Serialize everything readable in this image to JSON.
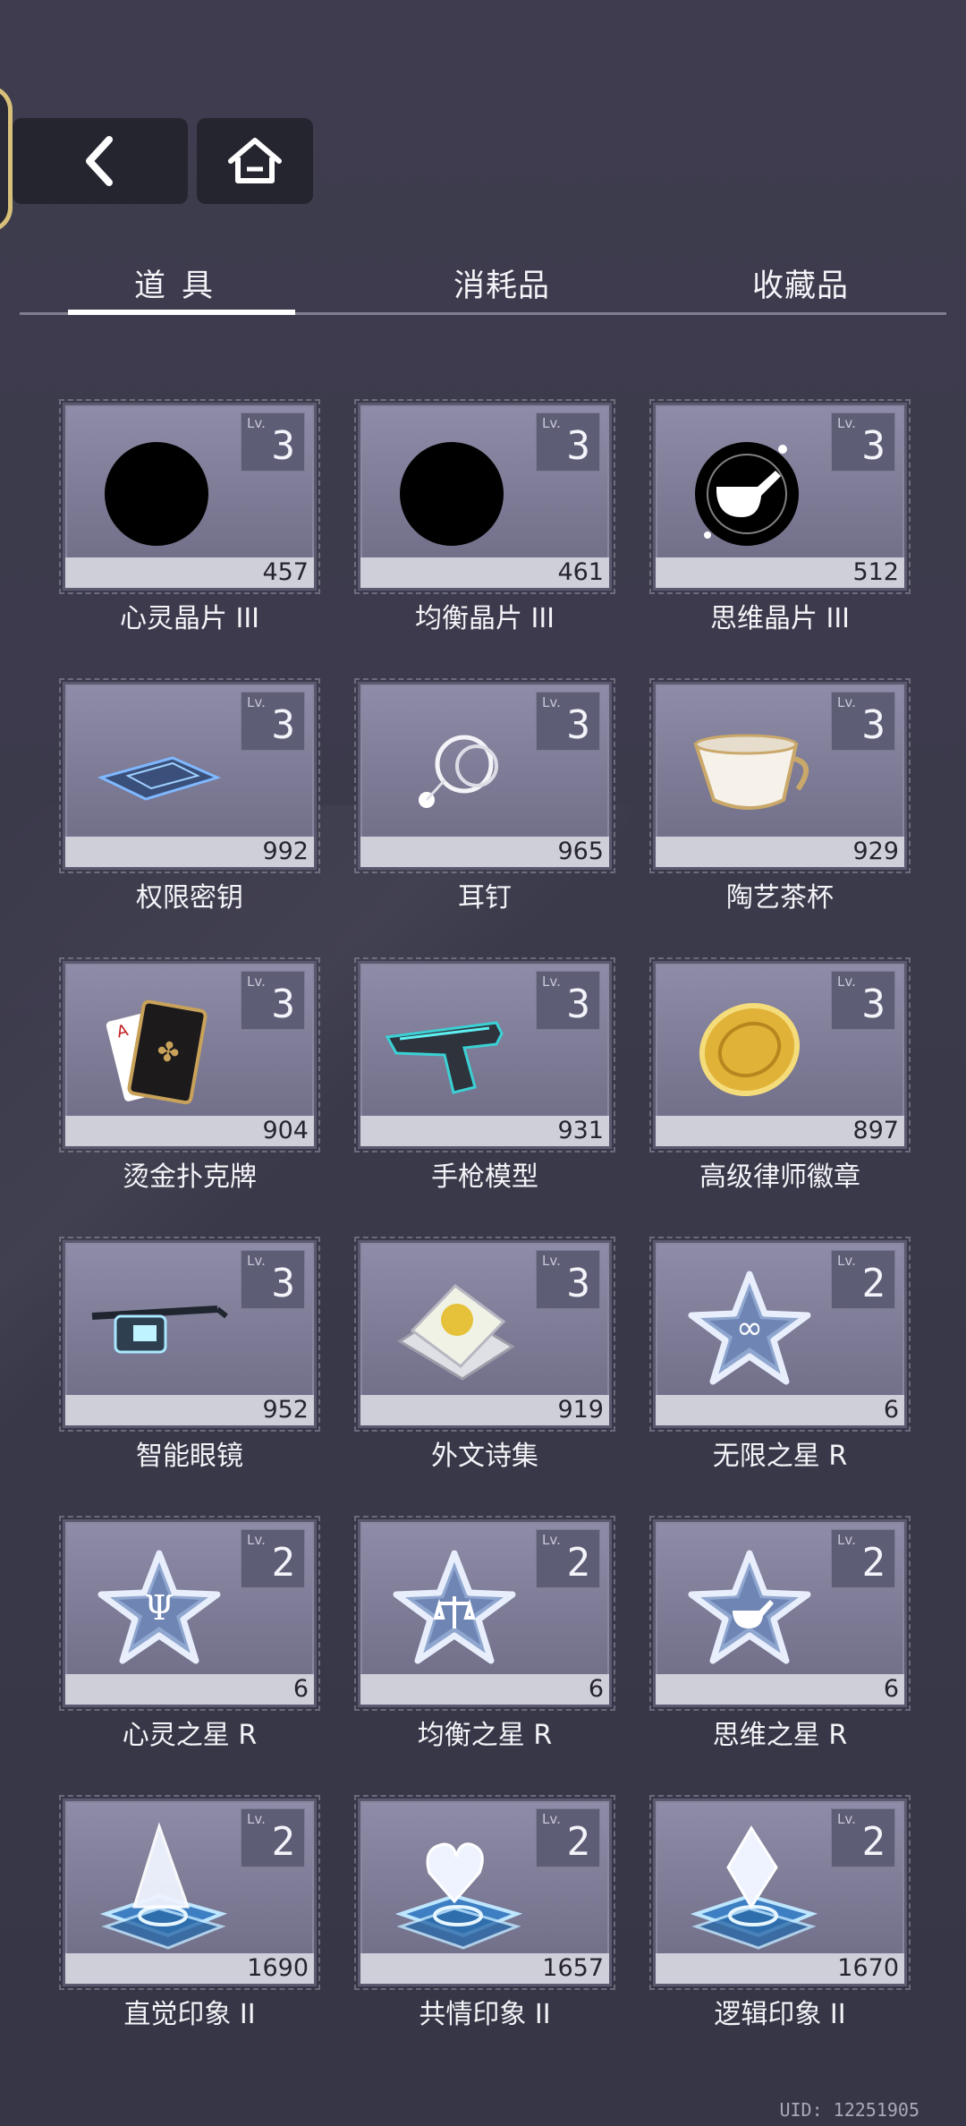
{
  "nav": {
    "back": "back",
    "home": "home"
  },
  "tabs": [
    {
      "label": "道具",
      "active": true
    },
    {
      "label": "消耗品",
      "active": false
    },
    {
      "label": "收藏品",
      "active": false
    }
  ],
  "lv_label": "Lv.",
  "items": [
    {
      "name": "心灵晶片 III",
      "level": "3",
      "count": "457",
      "icon": "psi-crystal-disc-icon"
    },
    {
      "name": "均衡晶片 III",
      "level": "3",
      "count": "461",
      "icon": "scales-crystal-disc-icon"
    },
    {
      "name": "思维晶片 III",
      "level": "3",
      "count": "512",
      "icon": "pipe-crystal-disc-icon"
    },
    {
      "name": "权限密钥",
      "level": "3",
      "count": "992",
      "icon": "keycard-icon"
    },
    {
      "name": "耳钉",
      "level": "3",
      "count": "965",
      "icon": "earring-icon"
    },
    {
      "name": "陶艺茶杯",
      "level": "3",
      "count": "929",
      "icon": "teacup-icon"
    },
    {
      "name": "烫金扑克牌",
      "level": "3",
      "count": "904",
      "icon": "playing-cards-icon"
    },
    {
      "name": "手枪模型",
      "level": "3",
      "count": "931",
      "icon": "pistol-icon"
    },
    {
      "name": "高级律师徽章",
      "level": "3",
      "count": "897",
      "icon": "gold-badge-icon"
    },
    {
      "name": "智能眼镜",
      "level": "3",
      "count": "952",
      "icon": "smart-glasses-icon"
    },
    {
      "name": "外文诗集",
      "level": "3",
      "count": "919",
      "icon": "poetry-book-icon"
    },
    {
      "name": "无限之星 R",
      "level": "2",
      "count": "6",
      "icon": "infinity-star-icon"
    },
    {
      "name": "心灵之星 R",
      "level": "2",
      "count": "6",
      "icon": "psi-star-icon"
    },
    {
      "name": "均衡之星 R",
      "level": "2",
      "count": "6",
      "icon": "scales-star-icon"
    },
    {
      "name": "思维之星 R",
      "level": "2",
      "count": "6",
      "icon": "pipe-star-icon"
    },
    {
      "name": "直觉印象 II",
      "level": "2",
      "count": "1690",
      "icon": "triangle-hologram-icon"
    },
    {
      "name": "共情印象 II",
      "level": "2",
      "count": "1657",
      "icon": "heart-hologram-icon"
    },
    {
      "name": "逻辑印象 II",
      "level": "2",
      "count": "1670",
      "icon": "diamond-hologram-icon"
    }
  ],
  "uid": "UID: 12251905",
  "colors": {
    "background": "#3b3a4b",
    "card": "#7b7993",
    "quantity_bar": "#cfcfd9",
    "side_tab_border": "#d8c07a"
  }
}
